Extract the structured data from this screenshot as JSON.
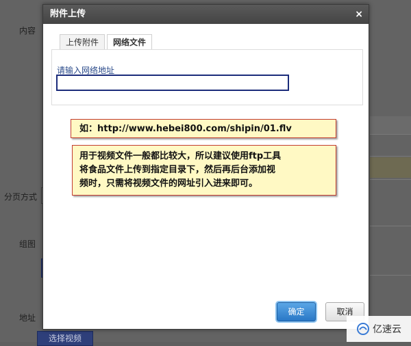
{
  "background": {
    "labels": {
      "content": "内容",
      "pagination": "分页方式",
      "group_image": "组图",
      "address": "地址"
    },
    "bottom_button": "选择视频"
  },
  "dialog": {
    "title": "附件上传",
    "close_symbol": "×",
    "tabs": [
      {
        "label": "上传附件",
        "active": false
      },
      {
        "label": "网络文件",
        "active": true
      }
    ],
    "field_label": "请输入网络地址",
    "url_value": "",
    "ok_label": "确定",
    "cancel_label": "取消"
  },
  "notes": {
    "example_prefix": "如：",
    "example_url": "http://www.hebei800.com/shipin/01.flv",
    "explanation_lines": [
      "用于视频文件一般都比较大，所以建议使用ftp工具",
      "将食品文件上传到指定目录下，然后再后台添加视",
      "频时，只需将视频文件的网址引入进来即可。"
    ]
  },
  "watermark": {
    "text": "亿速云"
  },
  "colors": {
    "note_bg": "#fff9c4",
    "note_border": "#c23b2f",
    "input_border": "#1a2b7a",
    "ok_button": "#2a78c6"
  }
}
